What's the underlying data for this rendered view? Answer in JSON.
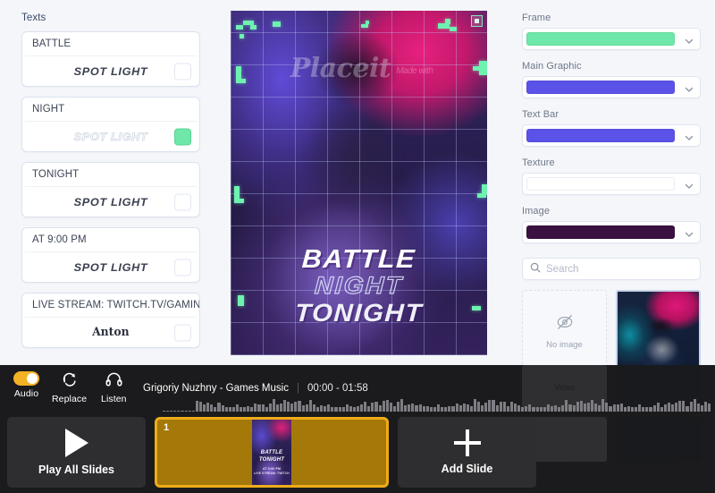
{
  "texts_panel": {
    "title": "Texts",
    "items": [
      {
        "value": "BATTLE",
        "font": "SPOT LIGHT",
        "font_style": "solid",
        "swatch": "#ffffff"
      },
      {
        "value": "NIGHT",
        "font": "SPOT LIGHT",
        "font_style": "hollow",
        "swatch": "#6ee7a8"
      },
      {
        "value": "TONIGHT",
        "font": "SPOT LIGHT",
        "font_style": "solid",
        "swatch": "#ffffff"
      },
      {
        "value": "AT 9:00 PM",
        "font": "SPOT LIGHT",
        "font_style": "solid",
        "swatch": "#ffffff"
      },
      {
        "value": "LIVE STREAM: TWITCH.TV/GAMINGCH",
        "font": "Anton",
        "font_style": "serif-bold",
        "swatch": "#ffffff"
      }
    ]
  },
  "canvas": {
    "watermark_main": "Placeit",
    "watermark_small": "Made with",
    "line1": "BATTLE",
    "line2": "NIGHT",
    "line3": "TONIGHT"
  },
  "right_panel": {
    "fields": [
      {
        "label": "Frame",
        "color": "#6ee7a8"
      },
      {
        "label": "Main Graphic",
        "color": "#5b52e8"
      },
      {
        "label": "Text Bar",
        "color": "#5b52e8"
      },
      {
        "label": "Texture",
        "color": ""
      },
      {
        "label": "Image",
        "color": "#3a1140"
      }
    ],
    "search_placeholder": "Search",
    "thumbnails": [
      {
        "type": "no-image",
        "label": "No image",
        "selected": false
      },
      {
        "type": "photo",
        "label": "",
        "selected": true
      }
    ]
  },
  "audio_bar": {
    "audio_label": "Audio",
    "audio_on": true,
    "replace_label": "Replace",
    "listen_label": "Listen",
    "track_name": "Grigoriy Nuzhny - Games Music",
    "track_time": "00:00 - 01:58"
  },
  "slides": {
    "play_all_label": "Play All Slides",
    "add_slide_label": "Add Slide",
    "current": {
      "number": "1",
      "line1": "BATTLE",
      "line2": "TONIGHT",
      "line3": "AT 9:00 PM",
      "line4": "LIVE STREAM: TWITCH"
    }
  },
  "background_overlay": {
    "video_label": "Video"
  },
  "colors": {
    "accent_yellow": "#f0ab1a",
    "toggle_on": "#f2b224",
    "panel_bg": "#f4f6f9",
    "dark_bg": "#1b1b1d"
  }
}
